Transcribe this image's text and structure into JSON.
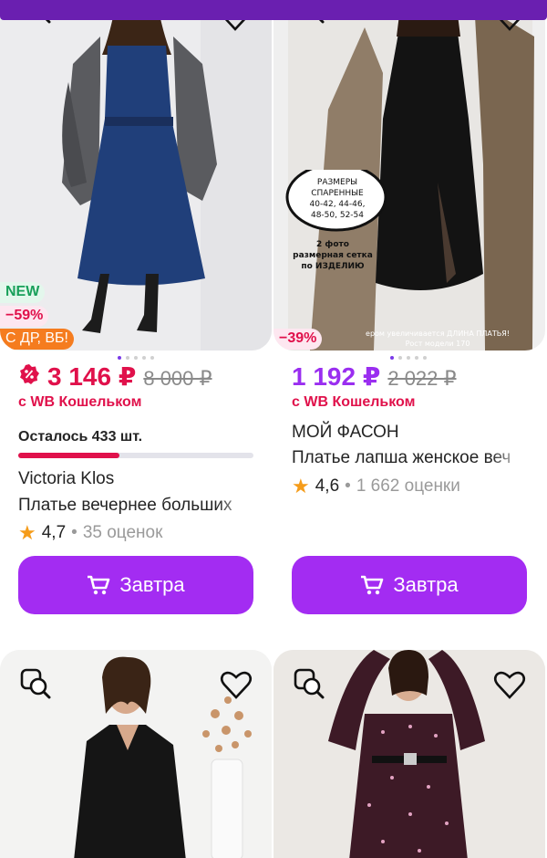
{
  "colors": {
    "brand": "#6a1fb0",
    "button": "#a32cf2",
    "price_red": "#e0114b",
    "price_purple": "#9a2ef0"
  },
  "products": [
    {
      "badges": {
        "new": "NEW",
        "discount": "−59%",
        "promo": "С ДР, ВБ!"
      },
      "price": "3 146 ₽",
      "old_price": "8 000 ₽",
      "wallet": "с WB Кошельком",
      "stock": "Осталось 433 шт.",
      "stock_level": 0.43,
      "brand": "Victoria Klos",
      "name": "Платье вечернее больших",
      "rating": "4,7",
      "reviews": "35 оценок",
      "cart_label": "Завтра"
    },
    {
      "badges": {
        "discount": "−39%"
      },
      "photo_text": {
        "line1": "РАЗМЕРЫ",
        "line2": "СПАРЕННЫЕ",
        "line3": "40-42, 44-46,",
        "line4": "48-50, 52-54",
        "line5": "2 фото",
        "line6": "размерная сетка",
        "line7": "по ИЗДЕЛИЮ",
        "line8": "ером увеличивается ДЛИНА ПЛАТЬЯ!",
        "line9": "Рост модели 170"
      },
      "price": "1 192 ₽",
      "old_price": "2 022 ₽",
      "wallet": "с WB Кошельком",
      "brand": "МОЙ ФАСОН",
      "name": "Платье лапша женское веч",
      "rating": "4,6",
      "reviews": "1 662 оценки",
      "cart_label": "Завтра"
    }
  ],
  "icons": [
    "search-similar-icon",
    "heart-icon",
    "cart-icon",
    "star-icon"
  ]
}
